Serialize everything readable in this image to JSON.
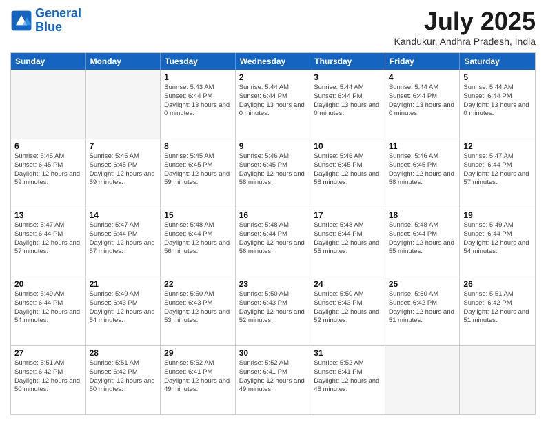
{
  "header": {
    "logo_line1": "General",
    "logo_line2": "Blue",
    "month_title": "July 2025",
    "location": "Kandukur, Andhra Pradesh, India"
  },
  "days_of_week": [
    "Sunday",
    "Monday",
    "Tuesday",
    "Wednesday",
    "Thursday",
    "Friday",
    "Saturday"
  ],
  "rows": [
    [
      {
        "day": "",
        "empty": true
      },
      {
        "day": "",
        "empty": true
      },
      {
        "day": "1",
        "sunrise": "Sunrise: 5:43 AM",
        "sunset": "Sunset: 6:44 PM",
        "daylight": "Daylight: 13 hours and 0 minutes."
      },
      {
        "day": "2",
        "sunrise": "Sunrise: 5:44 AM",
        "sunset": "Sunset: 6:44 PM",
        "daylight": "Daylight: 13 hours and 0 minutes."
      },
      {
        "day": "3",
        "sunrise": "Sunrise: 5:44 AM",
        "sunset": "Sunset: 6:44 PM",
        "daylight": "Daylight: 13 hours and 0 minutes."
      },
      {
        "day": "4",
        "sunrise": "Sunrise: 5:44 AM",
        "sunset": "Sunset: 6:44 PM",
        "daylight": "Daylight: 13 hours and 0 minutes."
      },
      {
        "day": "5",
        "sunrise": "Sunrise: 5:44 AM",
        "sunset": "Sunset: 6:44 PM",
        "daylight": "Daylight: 13 hours and 0 minutes."
      }
    ],
    [
      {
        "day": "6",
        "sunrise": "Sunrise: 5:45 AM",
        "sunset": "Sunset: 6:45 PM",
        "daylight": "Daylight: 12 hours and 59 minutes."
      },
      {
        "day": "7",
        "sunrise": "Sunrise: 5:45 AM",
        "sunset": "Sunset: 6:45 PM",
        "daylight": "Daylight: 12 hours and 59 minutes."
      },
      {
        "day": "8",
        "sunrise": "Sunrise: 5:45 AM",
        "sunset": "Sunset: 6:45 PM",
        "daylight": "Daylight: 12 hours and 59 minutes."
      },
      {
        "day": "9",
        "sunrise": "Sunrise: 5:46 AM",
        "sunset": "Sunset: 6:45 PM",
        "daylight": "Daylight: 12 hours and 58 minutes."
      },
      {
        "day": "10",
        "sunrise": "Sunrise: 5:46 AM",
        "sunset": "Sunset: 6:45 PM",
        "daylight": "Daylight: 12 hours and 58 minutes."
      },
      {
        "day": "11",
        "sunrise": "Sunrise: 5:46 AM",
        "sunset": "Sunset: 6:45 PM",
        "daylight": "Daylight: 12 hours and 58 minutes."
      },
      {
        "day": "12",
        "sunrise": "Sunrise: 5:47 AM",
        "sunset": "Sunset: 6:44 PM",
        "daylight": "Daylight: 12 hours and 57 minutes."
      }
    ],
    [
      {
        "day": "13",
        "sunrise": "Sunrise: 5:47 AM",
        "sunset": "Sunset: 6:44 PM",
        "daylight": "Daylight: 12 hours and 57 minutes."
      },
      {
        "day": "14",
        "sunrise": "Sunrise: 5:47 AM",
        "sunset": "Sunset: 6:44 PM",
        "daylight": "Daylight: 12 hours and 57 minutes."
      },
      {
        "day": "15",
        "sunrise": "Sunrise: 5:48 AM",
        "sunset": "Sunset: 6:44 PM",
        "daylight": "Daylight: 12 hours and 56 minutes."
      },
      {
        "day": "16",
        "sunrise": "Sunrise: 5:48 AM",
        "sunset": "Sunset: 6:44 PM",
        "daylight": "Daylight: 12 hours and 56 minutes."
      },
      {
        "day": "17",
        "sunrise": "Sunrise: 5:48 AM",
        "sunset": "Sunset: 6:44 PM",
        "daylight": "Daylight: 12 hours and 55 minutes."
      },
      {
        "day": "18",
        "sunrise": "Sunrise: 5:48 AM",
        "sunset": "Sunset: 6:44 PM",
        "daylight": "Daylight: 12 hours and 55 minutes."
      },
      {
        "day": "19",
        "sunrise": "Sunrise: 5:49 AM",
        "sunset": "Sunset: 6:44 PM",
        "daylight": "Daylight: 12 hours and 54 minutes."
      }
    ],
    [
      {
        "day": "20",
        "sunrise": "Sunrise: 5:49 AM",
        "sunset": "Sunset: 6:44 PM",
        "daylight": "Daylight: 12 hours and 54 minutes."
      },
      {
        "day": "21",
        "sunrise": "Sunrise: 5:49 AM",
        "sunset": "Sunset: 6:43 PM",
        "daylight": "Daylight: 12 hours and 54 minutes."
      },
      {
        "day": "22",
        "sunrise": "Sunrise: 5:50 AM",
        "sunset": "Sunset: 6:43 PM",
        "daylight": "Daylight: 12 hours and 53 minutes."
      },
      {
        "day": "23",
        "sunrise": "Sunrise: 5:50 AM",
        "sunset": "Sunset: 6:43 PM",
        "daylight": "Daylight: 12 hours and 52 minutes."
      },
      {
        "day": "24",
        "sunrise": "Sunrise: 5:50 AM",
        "sunset": "Sunset: 6:43 PM",
        "daylight": "Daylight: 12 hours and 52 minutes."
      },
      {
        "day": "25",
        "sunrise": "Sunrise: 5:50 AM",
        "sunset": "Sunset: 6:42 PM",
        "daylight": "Daylight: 12 hours and 51 minutes."
      },
      {
        "day": "26",
        "sunrise": "Sunrise: 5:51 AM",
        "sunset": "Sunset: 6:42 PM",
        "daylight": "Daylight: 12 hours and 51 minutes."
      }
    ],
    [
      {
        "day": "27",
        "sunrise": "Sunrise: 5:51 AM",
        "sunset": "Sunset: 6:42 PM",
        "daylight": "Daylight: 12 hours and 50 minutes."
      },
      {
        "day": "28",
        "sunrise": "Sunrise: 5:51 AM",
        "sunset": "Sunset: 6:42 PM",
        "daylight": "Daylight: 12 hours and 50 minutes."
      },
      {
        "day": "29",
        "sunrise": "Sunrise: 5:52 AM",
        "sunset": "Sunset: 6:41 PM",
        "daylight": "Daylight: 12 hours and 49 minutes."
      },
      {
        "day": "30",
        "sunrise": "Sunrise: 5:52 AM",
        "sunset": "Sunset: 6:41 PM",
        "daylight": "Daylight: 12 hours and 49 minutes."
      },
      {
        "day": "31",
        "sunrise": "Sunrise: 5:52 AM",
        "sunset": "Sunset: 6:41 PM",
        "daylight": "Daylight: 12 hours and 48 minutes."
      },
      {
        "day": "",
        "empty": true
      },
      {
        "day": "",
        "empty": true
      }
    ]
  ]
}
